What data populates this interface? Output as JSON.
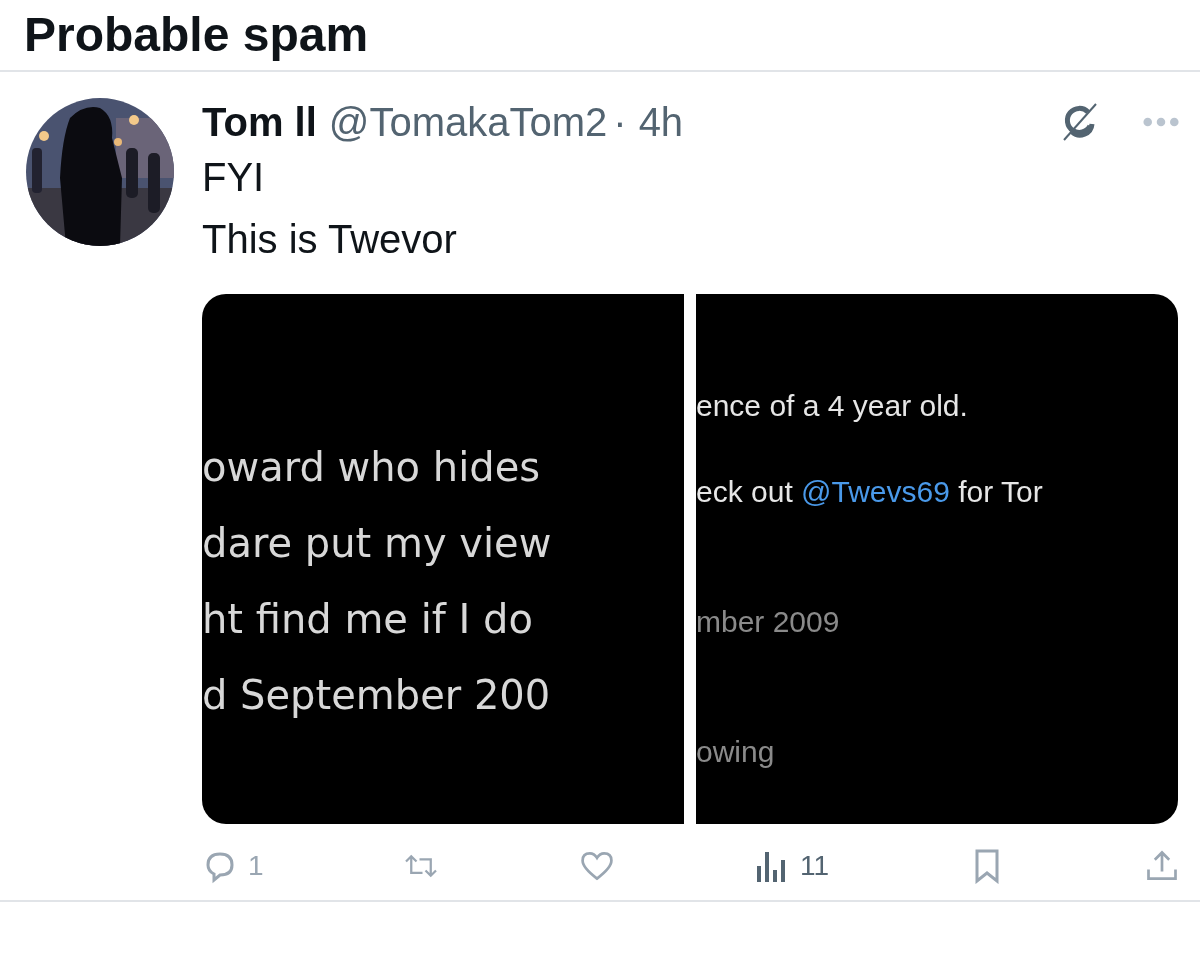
{
  "section_title": "Probable spam",
  "tweet": {
    "name": "Tom ll",
    "handle": "@TomakaTom2",
    "separator": "·",
    "time": "4h",
    "lines": [
      "FYI",
      "This is Twevor"
    ],
    "media": [
      {
        "lines": [
          {
            "kind": "text",
            "parts": [
              {
                "kind": "plain",
                "text": "oward who hides"
              }
            ]
          },
          {
            "kind": "text",
            "parts": [
              {
                "kind": "plain",
                "text": "dare put my view"
              }
            ]
          },
          {
            "kind": "text",
            "parts": [
              {
                "kind": "plain",
                "text": "ht find me if I do"
              }
            ]
          },
          {
            "kind": "text",
            "parts": [
              {
                "kind": "plain",
                "text": "d September 200"
              }
            ]
          }
        ]
      },
      {
        "lines": [
          {
            "kind": "text",
            "parts": [
              {
                "kind": "plain",
                "text": "ence of a 4 year old."
              }
            ]
          },
          {
            "kind": "text",
            "parts": [
              {
                "kind": "plain",
                "text": "eck out "
              },
              {
                "kind": "link",
                "text": "@Twevs69"
              },
              {
                "kind": "plain",
                "text": " for Tor"
              }
            ]
          },
          {
            "kind": "text",
            "parts": [
              {
                "kind": "dim",
                "text": "mber 2009"
              }
            ]
          },
          {
            "kind": "text",
            "parts": [
              {
                "kind": "dim",
                "text": "owing"
              }
            ]
          }
        ]
      }
    ],
    "actions": [
      {
        "kind": "reply",
        "count": "1",
        "active": false
      },
      {
        "kind": "retweet",
        "active": false
      },
      {
        "kind": "like",
        "active": false
      },
      {
        "kind": "views",
        "count": "11",
        "active": true
      },
      {
        "kind": "bookmark",
        "active": false
      },
      {
        "kind": "share",
        "active": false
      }
    ]
  }
}
